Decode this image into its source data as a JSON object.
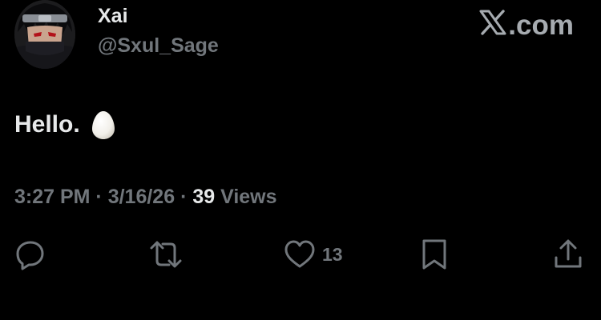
{
  "author": {
    "display_name": "Xai",
    "handle": "@Sxul_Sage",
    "avatar_icon": "anime-avatar"
  },
  "brand": {
    "text": ".com",
    "icon": "x-logo-icon"
  },
  "tweet": {
    "text": "Hello.",
    "emoji": "egg-emoji"
  },
  "meta": {
    "time": "3:27 PM",
    "separator": " · ",
    "date": "3/16/26",
    "views_count": "39",
    "views_label": " Views"
  },
  "actions": {
    "reply_icon": "reply-icon",
    "repost_icon": "repost-icon",
    "like_icon": "heart-icon",
    "like_count": "13",
    "bookmark_icon": "bookmark-icon",
    "share_icon": "share-icon"
  },
  "colors": {
    "background": "#000000",
    "primary_text": "#e7e9ea",
    "secondary_text": "#71767b",
    "brand": "#a6abb0"
  }
}
